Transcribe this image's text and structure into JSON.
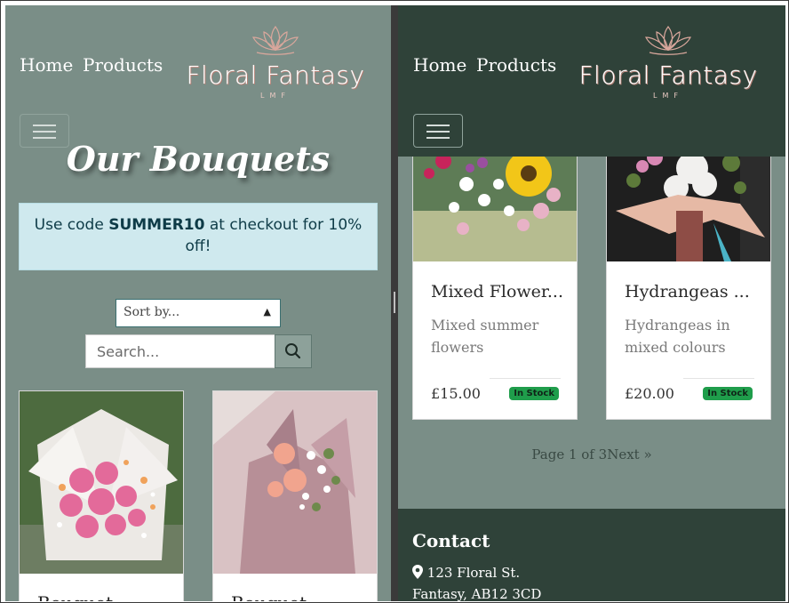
{
  "nav": {
    "links": [
      "Home",
      "Products"
    ],
    "brand": {
      "name": "Floral Fantasy",
      "sub": "LMF"
    }
  },
  "left": {
    "title": "Our Bouquets",
    "promo": {
      "prefix": "Use code ",
      "code": "SUMMER10",
      "suffix": " at checkout for 10% off!"
    },
    "sort": {
      "value": "Sort by..."
    },
    "search": {
      "placeholder": "Search..."
    },
    "cards": [
      {
        "title": "Bouquet..."
      },
      {
        "title": "Bouquet..."
      }
    ]
  },
  "right": {
    "cards": [
      {
        "title": "Mixed Flower...",
        "description": "Mixed summer flowers",
        "price": "£15.00",
        "badge": "In Stock"
      },
      {
        "title": "Hydrangeas ...",
        "description": "Hydrangeas in mixed colours",
        "price": "£20.00",
        "badge": "In Stock"
      }
    ],
    "pager": {
      "label": "Page 1 of 3",
      "next": "Next »"
    },
    "footer": {
      "title": "Contact",
      "line1": "123 Floral St.",
      "line2": "Fantasy, AB12 3CD"
    }
  },
  "colors": {
    "sage": "#7a8e87",
    "forest": "#2f4239",
    "badge": "#1f9d4b",
    "promo": "#cfe9ee"
  }
}
